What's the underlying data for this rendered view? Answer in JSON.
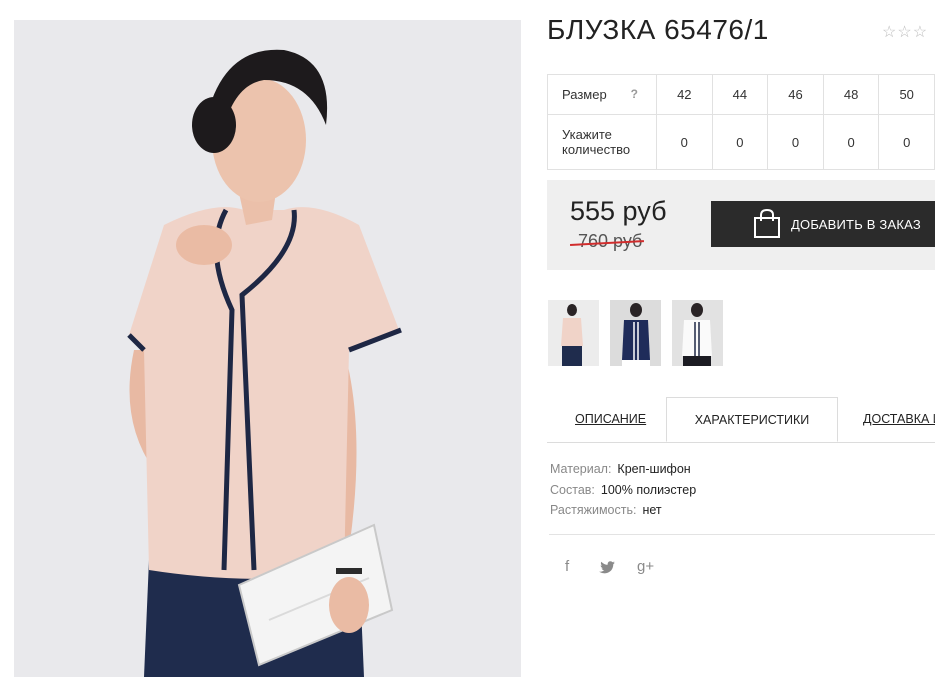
{
  "product": {
    "title": "БЛУЗКА 65476/1",
    "rating_stars": "☆☆☆"
  },
  "sizes": {
    "size_label": "Размер",
    "help_mark": "?",
    "qty_label": "Укажите количество",
    "values": [
      "42",
      "44",
      "46",
      "48",
      "50"
    ],
    "quantities": [
      "0",
      "0",
      "0",
      "0",
      "0"
    ]
  },
  "pricing": {
    "price": "555 руб",
    "old_price": "760 руб",
    "add_to_order": "ДОБАВИТЬ В ЗАКАЗ"
  },
  "thumbnails": [
    {
      "variant": "peach-blouse"
    },
    {
      "variant": "navy-blouse"
    },
    {
      "variant": "white-blouse"
    }
  ],
  "tabs": [
    {
      "label": "ОПИСАНИЕ"
    },
    {
      "label": "ХАРАКТЕРИСТИКИ"
    },
    {
      "label": "ДОСТАВКА И"
    }
  ],
  "characteristics": [
    {
      "key": "Материал:",
      "value": "Креп-шифон"
    },
    {
      "key": "Состав:",
      "value": "100% полиэстер"
    },
    {
      "key": "Растяжимость:",
      "value": "нет"
    }
  ],
  "social": {
    "facebook": "f",
    "googleplus": "g+"
  },
  "colors": {
    "button_bg": "#2b2b2b",
    "price_box_bg": "#efefef",
    "strike": "#d12d2d",
    "blouse": "#f0d3c8",
    "trim": "#1e2744"
  }
}
